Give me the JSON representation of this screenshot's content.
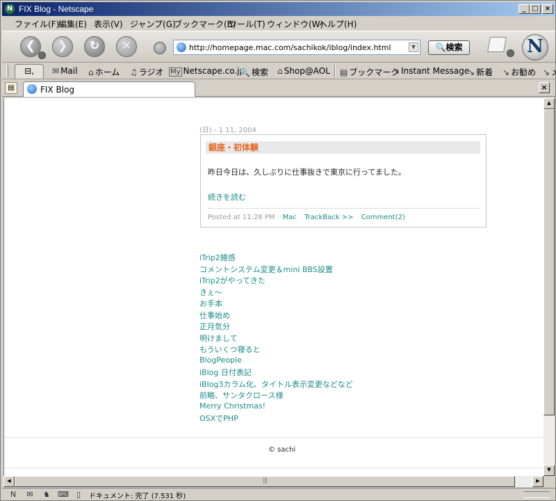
{
  "window": {
    "title": "FIX Blog - Netscape",
    "app_icon_glyph": "N",
    "minimize_glyph": "_",
    "maximize_glyph": "□",
    "close_glyph": "×"
  },
  "menu": [
    "ファイル(F)",
    "編集(E)",
    "表示(V)",
    "ジャンプ(G)",
    "ブックマーク(B)",
    "ツール(T)",
    "ウィンドウ(W)",
    "ヘルプ(H)"
  ],
  "nav": {
    "back_glyph": "❮",
    "forward_glyph": "❯",
    "reload_glyph": "↻",
    "stop_glyph": "✕",
    "url": "http://homepage.mac.com/sachikok/iblog/index.html",
    "search_label": "🔍検索",
    "logo_glyph": "N"
  },
  "personal_toolbar": {
    "tab_icon_glyph": "⊟,",
    "items": [
      {
        "icon": "✉",
        "label": "Mail"
      },
      {
        "icon": "⌂",
        "label": "ホーム"
      },
      {
        "icon": "♫",
        "label": "ラジオ"
      },
      {
        "icon": "My",
        "label": "Netscape.co.jp"
      },
      {
        "icon": "🔍",
        "label": "検索"
      },
      {
        "icon": "⌂",
        "label": "Shop@AOL"
      },
      {
        "icon": "▤",
        "label": "ブックマーク"
      },
      {
        "icon": "↘",
        "label": "Instant Message"
      },
      {
        "icon": "↘",
        "label": "新着"
      },
      {
        "icon": "↘",
        "label": "お勧め"
      },
      {
        "icon": "↘",
        "label": "メ"
      }
    ]
  },
  "tabs": {
    "new_tab_glyph": "▤",
    "active_label": "FIX Blog",
    "close_glyph": "×"
  },
  "blog": {
    "date": "(日) - 1 11, 2004",
    "entry": {
      "title": "銀座・初体験",
      "body": "昨日今日は、久しぶりに仕事抜きで東京に行ってました。",
      "more": "続きを読む",
      "posted": "Posted at 11:28 PM",
      "category": "Mac",
      "trackback": "TrackBack >>",
      "comments": "Comment(2)"
    },
    "recent": [
      "iTrip2雑感",
      "コメントシステム変更＆mini BBS設置",
      "iTrip2がやってきた",
      "きぇ〜",
      "お手本",
      "仕事始め",
      "正月気分",
      "明けまして",
      "もういくつ寝ると",
      "BlogPeople",
      "iBlog 日付表記",
      "iBlog3カラム化、タイトル表示変更などなど",
      "前略、サンタクロース様",
      "Merry Christmas!",
      "OSXでPHP"
    ],
    "copyright": "© sachi"
  },
  "scroll": {
    "up_glyph": "▲",
    "down_glyph": "▼",
    "left_glyph": "◀",
    "right_glyph": "▶",
    "grip": "|||"
  },
  "status": {
    "text": "ドキュメント: 完了 (7.531 秒)",
    "icons": [
      "N",
      "✉",
      "♞",
      "⌨",
      "▯"
    ]
  }
}
